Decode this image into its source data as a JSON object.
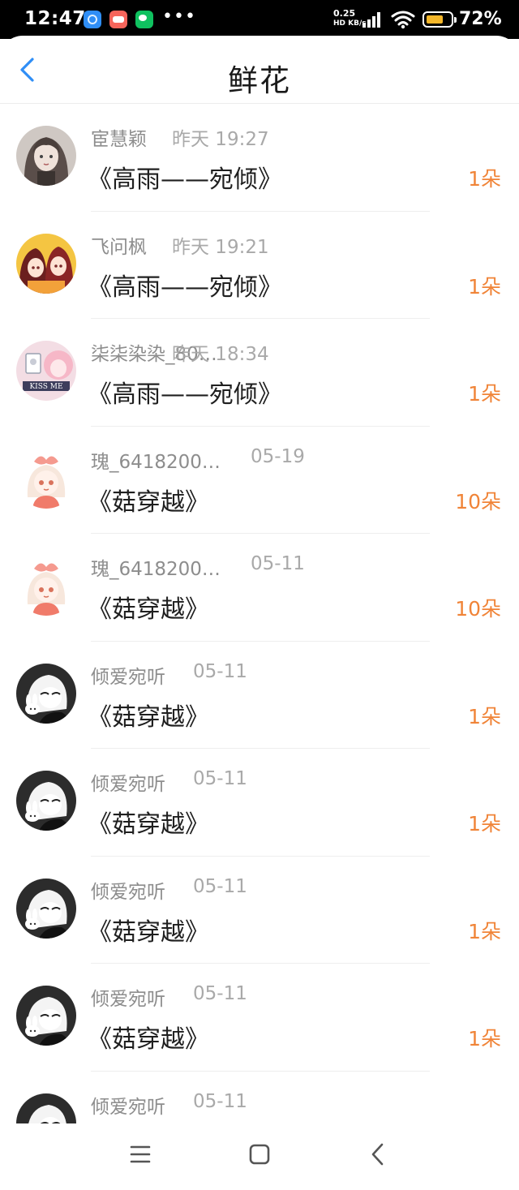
{
  "status_bar": {
    "time": "12:47",
    "more": "•••",
    "net_speed_value": "0.25",
    "net_speed_unit": "HD KB/s",
    "battery": "72%",
    "battery_level": 0.72
  },
  "header": {
    "title": "鲜花"
  },
  "records": [
    {
      "user": "宦慧颖",
      "time": "昨天 19:27",
      "work": "《高雨——宛倾》",
      "amount": "1朵",
      "avatar": "girl-dark-hair-avatar"
    },
    {
      "user": "飞问枫",
      "time": "昨天 19:21",
      "work": "《高雨——宛倾》",
      "amount": "1朵",
      "avatar": "two-girls-avatar"
    },
    {
      "user": "柒柒染染_80…",
      "time": "昨天 18:34",
      "work": "《高雨——宛倾》",
      "amount": "1朵",
      "avatar": "kiss-me-avatar"
    },
    {
      "user": "瑰_6418200…",
      "time": "05-19",
      "work": "《菇穿越》",
      "amount": "10朵",
      "avatar": "bow-girl-avatar"
    },
    {
      "user": "瑰_6418200…",
      "time": "05-11",
      "work": "《菇穿越》",
      "amount": "10朵",
      "avatar": "bow-girl-avatar"
    },
    {
      "user": "倾爱宛听",
      "time": "05-11",
      "work": "《菇穿越》",
      "amount": "1朵",
      "avatar": "bunny-avatar"
    },
    {
      "user": "倾爱宛听",
      "time": "05-11",
      "work": "《菇穿越》",
      "amount": "1朵",
      "avatar": "bunny-avatar"
    },
    {
      "user": "倾爱宛听",
      "time": "05-11",
      "work": "《菇穿越》",
      "amount": "1朵",
      "avatar": "bunny-avatar"
    },
    {
      "user": "倾爱宛听",
      "time": "05-11",
      "work": "《菇穿越》",
      "amount": "1朵",
      "avatar": "bunny-avatar"
    },
    {
      "user": "倾爱宛听",
      "time": "05-11",
      "work": "",
      "amount": "",
      "avatar": "bunny-avatar"
    }
  ],
  "colors": {
    "accent_blue": "#2f8ef6",
    "amount_orange": "#f08438",
    "secondary_text": "#8d8d8d"
  },
  "nav": {
    "menu_icon": "menu-icon",
    "home_icon": "home-icon",
    "back_icon": "back-triangle-icon"
  }
}
